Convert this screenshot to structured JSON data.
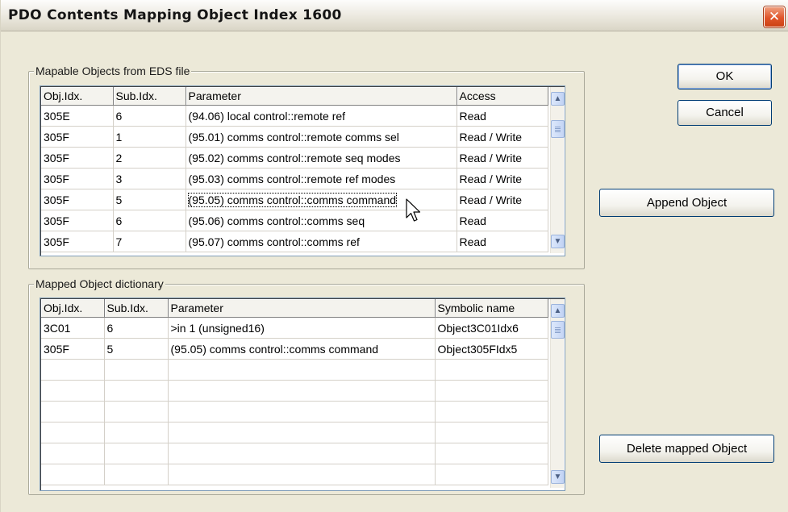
{
  "window": {
    "title": "PDO Contents Mapping Object Index 1600",
    "close_glyph": "✕"
  },
  "mapable": {
    "group_label": "Mapable Objects from EDS file",
    "columns": [
      "Obj.Idx.",
      "Sub.Idx.",
      "Parameter",
      "Access"
    ],
    "rows": [
      [
        "305E",
        "6",
        "(94.06) local control::remote ref",
        "Read"
      ],
      [
        "305F",
        "1",
        "(95.01) comms control::remote comms sel",
        "Read / Write"
      ],
      [
        "305F",
        "2",
        "(95.02) comms control::remote seq modes",
        "Read / Write"
      ],
      [
        "305F",
        "3",
        "(95.03) comms control::remote ref modes",
        "Read / Write"
      ],
      [
        "305F",
        "5",
        "(95.05) comms control::comms command",
        "Read / Write"
      ],
      [
        "305F",
        "6",
        "(95.06) comms control::comms seq",
        "Read"
      ],
      [
        "305F",
        "7",
        "(95.07) comms control::comms ref",
        "Read"
      ]
    ],
    "focused_row": 4
  },
  "mapped": {
    "group_label": "Mapped Object dictionary",
    "columns": [
      "Obj.Idx.",
      "Sub.Idx.",
      "Parameter",
      "Symbolic name"
    ],
    "rows": [
      [
        "3C01",
        "6",
        ">in 1 (unsigned16)",
        "Object3C01Idx6"
      ],
      [
        "305F",
        "5",
        "(95.05) comms control::comms command",
        "Object305FIdx5"
      ],
      [
        "",
        "",
        "",
        ""
      ],
      [
        "",
        "",
        "",
        ""
      ],
      [
        "",
        "",
        "",
        ""
      ],
      [
        "",
        "",
        "",
        ""
      ],
      [
        "",
        "",
        "",
        ""
      ],
      [
        "",
        "",
        "",
        ""
      ]
    ]
  },
  "buttons": {
    "ok": "OK",
    "cancel": "Cancel",
    "append": "Append Object",
    "delete": "Delete mapped Object"
  },
  "scrollbar": {
    "up_glyph": "▲",
    "down_glyph": "▼"
  },
  "colors": {
    "dialog_bg": "#ece9d8",
    "list_border": "#7f9db9",
    "close_button": "#e0552a",
    "default_button_border": "#003c74"
  }
}
